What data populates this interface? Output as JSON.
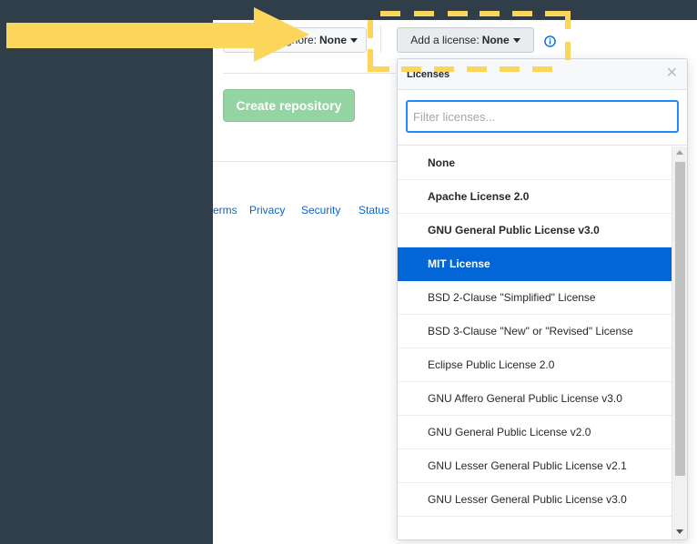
{
  "colors": {
    "sidebar_bg": "#2f3e48",
    "accent_yellow": "#fcd55b",
    "create_button_bg": "#94d3a2",
    "selected_item_bg": "#0366d6",
    "link": "#0366d6"
  },
  "toolbar": {
    "gitignore_label_visible": "gnore:",
    "gitignore_value": "None",
    "license_label": "Add a license:",
    "license_value": "None",
    "info_icon": "info-circle-icon"
  },
  "main": {
    "create_button": "Create repository"
  },
  "footer": {
    "links": [
      "erms",
      "Privacy",
      "Security",
      "Status"
    ]
  },
  "dropdown": {
    "title": "Licenses",
    "close_icon": "close-icon",
    "filter_placeholder": "Filter licenses...",
    "selected": "MIT License",
    "items": [
      "None",
      "Apache License 2.0",
      "GNU General Public License v3.0",
      "MIT License",
      "BSD 2-Clause \"Simplified\" License",
      "BSD 3-Clause \"New\" or \"Revised\" License",
      "Eclipse Public License 2.0",
      "GNU Affero General Public License v3.0",
      "GNU General Public License v2.0",
      "GNU Lesser General Public License v2.1",
      "GNU Lesser General Public License v3.0"
    ]
  },
  "annotation": {
    "arrow_icon": "arrow-right-icon",
    "highlight_box": "dashed-highlight-box"
  }
}
